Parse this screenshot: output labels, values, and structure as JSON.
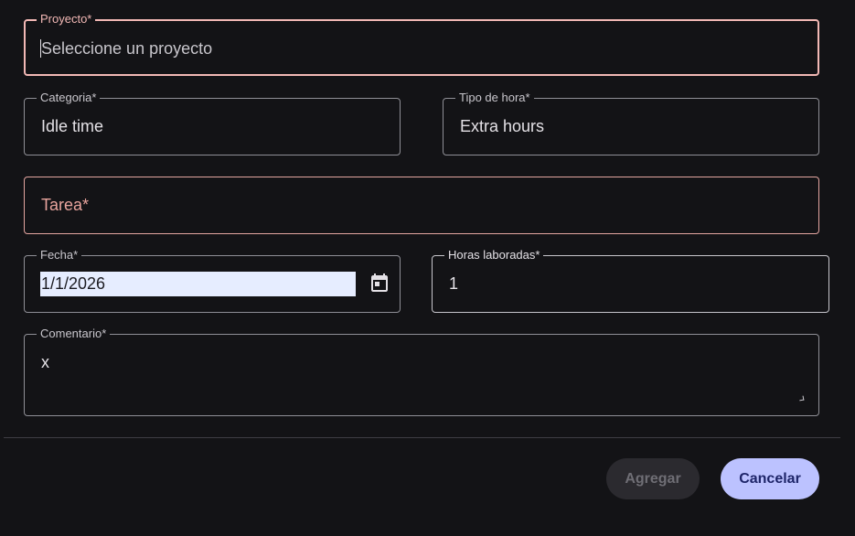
{
  "form": {
    "proyecto": {
      "label": "Proyecto*",
      "placeholder": "Seleccione un proyecto"
    },
    "categoria": {
      "label": "Categoria*",
      "value": "Idle time"
    },
    "tipo_hora": {
      "label": "Tipo de hora*",
      "value": "Extra hours"
    },
    "tarea": {
      "label": "Tarea*"
    },
    "fecha": {
      "label": "Fecha*",
      "value": "1/1/2026",
      "icon": "calendar-icon"
    },
    "horas": {
      "label": "Horas laboradas*",
      "value": "1"
    },
    "comentario": {
      "label": "Comentario*",
      "value": "x"
    }
  },
  "actions": {
    "agregar_label": "Agregar",
    "cancelar_label": "Cancelar"
  },
  "colors": {
    "background": "#131316",
    "error": "#f2b8b5",
    "primary_button": "#bcc2ff",
    "disabled_button": "#2b2a2f"
  }
}
